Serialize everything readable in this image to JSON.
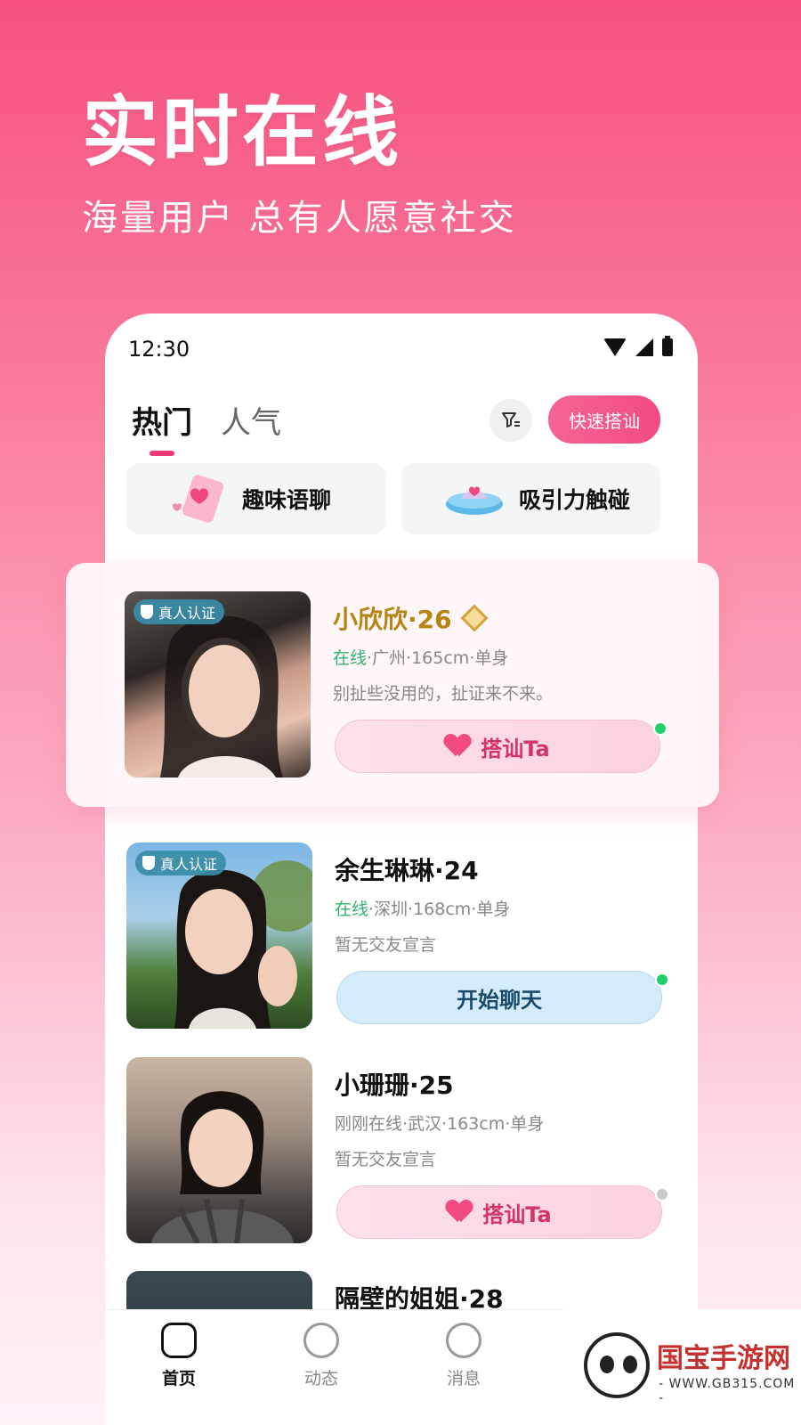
{
  "hero": {
    "title": "实时在线",
    "subtitle": "海量用户 总有人愿意社交"
  },
  "statusbar": {
    "time": "12:30"
  },
  "tabs": [
    {
      "label": "热门",
      "active": true
    },
    {
      "label": "人气",
      "active": false
    }
  ],
  "header": {
    "filter_icon": "filter-icon",
    "quick_button": "快速搭讪"
  },
  "features": [
    {
      "label": "趣味语聊",
      "icon": "phone-heart-icon"
    },
    {
      "label": "吸引力触碰",
      "icon": "ufo-icon"
    }
  ],
  "profiles": [
    {
      "name": "小欣欣·26",
      "vip": true,
      "verified": "真人认证",
      "status": "在线",
      "details": "·广州·165cm·单身",
      "bio": "别扯些没用的，扯证来不来。",
      "action": "搭讪Ta",
      "online": true
    },
    {
      "name": "余生琳琳·24",
      "vip": false,
      "verified": "真人认证",
      "status": "在线",
      "details": "·深圳·168cm·单身",
      "bio": "暂无交友宣言",
      "action": "开始聊天",
      "online": true
    },
    {
      "name": "小珊珊·25",
      "vip": false,
      "verified": "",
      "status": "",
      "details": "刚刚在线·武汉·163cm·单身",
      "bio": "暂无交友宣言",
      "action": "搭讪Ta",
      "online": false
    },
    {
      "name": "隔壁的姐姐·28"
    }
  ],
  "nav": [
    {
      "label": "首页",
      "icon": "home-icon",
      "active": true
    },
    {
      "label": "动态",
      "icon": "star-icon",
      "active": false
    },
    {
      "label": "消息",
      "icon": "message-icon",
      "active": false
    }
  ],
  "watermark": {
    "text": "国宝手游网",
    "url": "- WWW.GB315.COM -"
  },
  "colors": {
    "accent": "#f24b81",
    "online": "#2fb36f",
    "vip": "#b58411"
  }
}
